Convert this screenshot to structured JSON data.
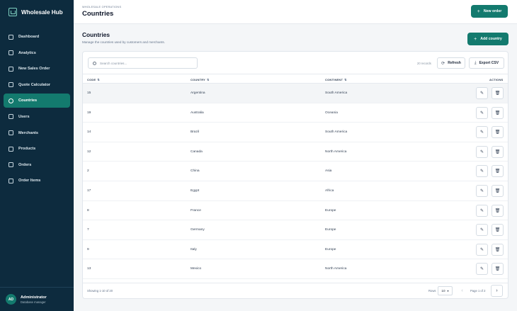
{
  "app": {
    "name": "Wholesale Hub"
  },
  "sidebar": {
    "items": [
      {
        "label": "Dashboard",
        "icon": "dashboard-icon",
        "active": false
      },
      {
        "label": "Analytics",
        "icon": "chart-icon",
        "active": false
      },
      {
        "label": "New Sales Order",
        "icon": "cart-icon",
        "active": false
      },
      {
        "label": "Quote Calculator",
        "icon": "calculator-icon",
        "active": false
      },
      {
        "label": "Countries",
        "icon": "globe-icon",
        "active": true
      },
      {
        "label": "Users",
        "icon": "users-icon",
        "active": false
      },
      {
        "label": "Merchants",
        "icon": "store-icon",
        "active": false
      },
      {
        "label": "Products",
        "icon": "box-icon",
        "active": false
      },
      {
        "label": "Orders",
        "icon": "orders-icon",
        "active": false
      },
      {
        "label": "Order Items",
        "icon": "list-icon",
        "active": false
      }
    ],
    "user": {
      "initials": "AD",
      "name": "Administrator",
      "role": "Database manager"
    }
  },
  "header": {
    "eyebrow": "WHOLESALE OPERATIONS",
    "title": "Countries",
    "new_order_label": "New order"
  },
  "section": {
    "title": "Countries",
    "subtitle": "Manage the countries used by customers and merchants.",
    "add_label": "Add country"
  },
  "toolbar": {
    "search_placeholder": "Search countries...",
    "records": "20 records",
    "refresh_label": "Refresh",
    "export_label": "Export CSV"
  },
  "table": {
    "columns": [
      "CODE",
      "COUNTRY",
      "CONTINENT",
      "ACTIONS"
    ],
    "rows": [
      {
        "code": "15",
        "country": "Argentina",
        "continent": "South America"
      },
      {
        "code": "19",
        "country": "Australia",
        "continent": "Oceania"
      },
      {
        "code": "14",
        "country": "Brazil",
        "continent": "South America"
      },
      {
        "code": "12",
        "country": "Canada",
        "continent": "North America"
      },
      {
        "code": "2",
        "country": "China",
        "continent": "Asia"
      },
      {
        "code": "17",
        "country": "Egypt",
        "continent": "Africa"
      },
      {
        "code": "8",
        "country": "France",
        "continent": "Europe"
      },
      {
        "code": "7",
        "country": "Germany",
        "continent": "Europe"
      },
      {
        "code": "9",
        "country": "Italy",
        "continent": "Europe"
      },
      {
        "code": "13",
        "country": "Mexico",
        "continent": "North America"
      }
    ]
  },
  "footer": {
    "showing": "Showing 1-10 of 20",
    "rows_label": "Rows",
    "rows_value": "10",
    "page_of": "Page 1 of 2"
  },
  "colors": {
    "sidebar": "#0d2b3e",
    "accent": "#137a6e"
  }
}
